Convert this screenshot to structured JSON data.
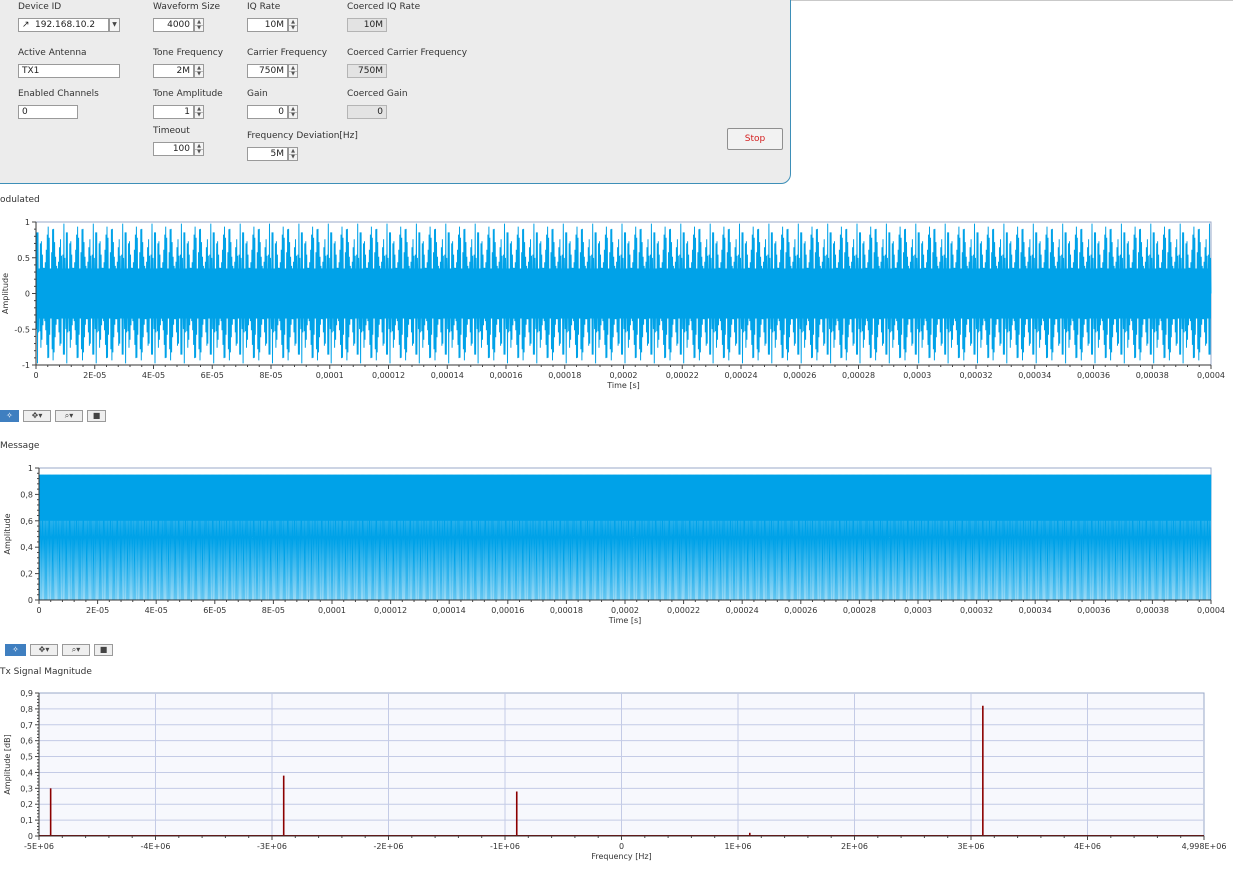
{
  "panel": {
    "device_id": {
      "label": "Device ID",
      "value": "192.168.10.2"
    },
    "waveform_size": {
      "label": "Waveform Size",
      "value": "4000"
    },
    "iq_rate": {
      "label": "IQ Rate",
      "value": "10M"
    },
    "coerced_iq_rate": {
      "label": "Coerced IQ Rate",
      "value": "10M"
    },
    "active_antenna": {
      "label": "Active Antenna",
      "value": "TX1"
    },
    "tone_frequency": {
      "label": "Tone Frequency",
      "value": "2M"
    },
    "carrier_frequency": {
      "label": "Carrier Frequency",
      "value": "750M"
    },
    "coerced_carrier_frequency": {
      "label": "Coerced Carrier Frequency",
      "value": "750M"
    },
    "enabled_channels": {
      "label": "Enabled Channels",
      "value": "0"
    },
    "tone_amplitude": {
      "label": "Tone Amplitude",
      "value": "1"
    },
    "gain": {
      "label": "Gain",
      "value": "0"
    },
    "coerced_gain": {
      "label": "Coerced Gain",
      "value": "0"
    },
    "timeout": {
      "label": "Timeout",
      "value": "100"
    },
    "frequency_deviation": {
      "label": "Frequency Deviation[Hz]",
      "value": "5M"
    },
    "stop_label": "Stop"
  },
  "toolbar": {
    "cursor_icon": "crosshair-icon",
    "pan_icon": "pan-arrows-icon",
    "zoom_icon": "zoom-magnifier-icon",
    "scale_icon": "autoscale-icon"
  },
  "colors": {
    "waveform": "#00a2e8",
    "spectrum": "#8b0000",
    "panel_border": "#3d8fb8",
    "stop_text": "#d42020"
  },
  "chart_data": [
    {
      "type": "line",
      "title": "odulated",
      "xlabel": "Time [s]",
      "ylabel": "Amplitude",
      "xlim": [
        0,
        0.0004
      ],
      "ylim": [
        -1,
        1
      ],
      "x_ticks": [
        "0",
        "2E-05",
        "4E-05",
        "6E-05",
        "8E-05",
        "0,0001",
        "0,00012",
        "0,00014",
        "0,00016",
        "0,00018",
        "0,0002",
        "0,00022",
        "0,00024",
        "0,00026",
        "0,00028",
        "0,0003",
        "0,00032",
        "0,00034",
        "0,00036",
        "0,00038",
        "0,0004"
      ],
      "y_ticks": [
        "1",
        "0.5",
        "0",
        "-0.5",
        "-1"
      ],
      "series": [
        {
          "description": "FM modulated waveform oscillating between -1 and 1",
          "envelope_min": -1,
          "envelope_max": 1
        }
      ]
    },
    {
      "type": "line",
      "title": "Message",
      "xlabel": "Time [s]",
      "ylabel": "Amplitude",
      "xlim": [
        0,
        0.0004
      ],
      "ylim": [
        0,
        1
      ],
      "x_ticks": [
        "0",
        "2E-05",
        "4E-05",
        "6E-05",
        "8E-05",
        "0,0001",
        "0,00012",
        "0,00014",
        "0,00016",
        "0,00018",
        "0,0002",
        "0,00022",
        "0,00024",
        "0,00026",
        "0,00028",
        "0,0003",
        "0,00032",
        "0,00034",
        "0,00036",
        "0,00038",
        "0,0004"
      ],
      "y_ticks": [
        "1",
        "0,8",
        "0,6",
        "0,4",
        "0,2",
        "0"
      ],
      "series": [
        {
          "description": "message tone oscillating between 0 and about 0.95, dense band from 0.6 to 0.95",
          "min": 0,
          "max": 0.95
        }
      ]
    },
    {
      "type": "line",
      "title": "Tx Signal Magnitude",
      "xlabel": "Frequency [Hz]",
      "ylabel": "Amplitude [dB]",
      "xlim": [
        -5000000,
        4998000
      ],
      "ylim": [
        0,
        0.9
      ],
      "grid": true,
      "x_ticks": [
        "-5E+06",
        "-4E+06",
        "-3E+06",
        "-2E+06",
        "-1E+06",
        "0",
        "1E+06",
        "2E+06",
        "3E+06",
        "4E+06",
        "4,998E+06"
      ],
      "y_ticks": [
        "0,9",
        "0,8",
        "0,7",
        "0,6",
        "0,5",
        "0,4",
        "0,3",
        "0,2",
        "0,1",
        "0"
      ],
      "peaks": [
        {
          "x": -4900000,
          "y": 0.3
        },
        {
          "x": -2900000,
          "y": 0.38
        },
        {
          "x": -900000,
          "y": 0.28
        },
        {
          "x": 1100000,
          "y": 0.02
        },
        {
          "x": 3100000,
          "y": 0.82
        }
      ]
    }
  ]
}
